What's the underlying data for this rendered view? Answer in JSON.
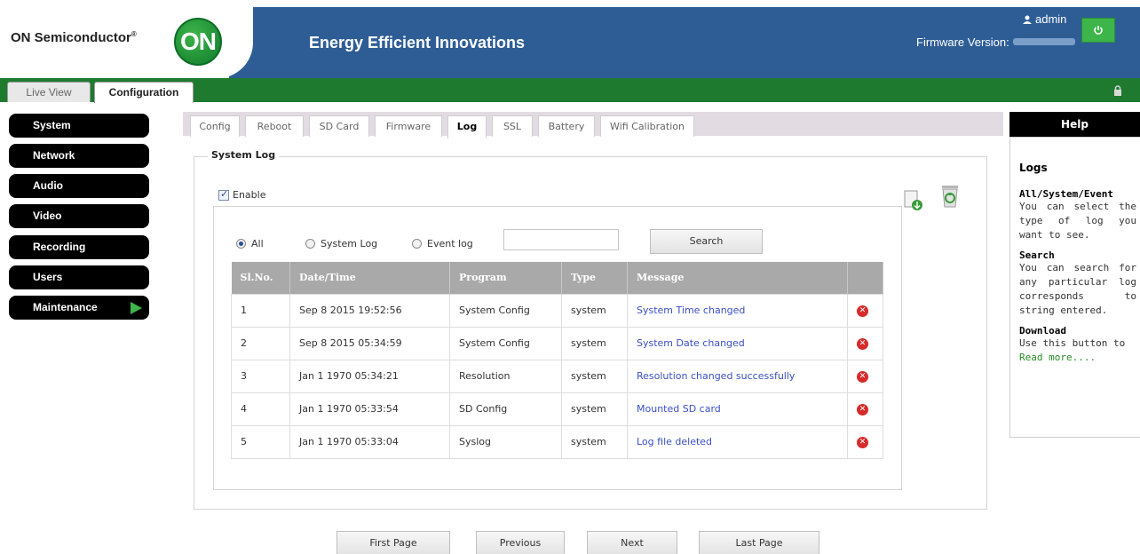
{
  "header": {
    "brand": "ON Semiconductor",
    "brand_mark": "®",
    "logo_text": "ON",
    "tagline": "Energy Efficient Innovations",
    "user": "admin",
    "firmware_label": "Firmware Version:"
  },
  "top_tabs": [
    {
      "label": "Live View"
    },
    {
      "label": "Configuration"
    }
  ],
  "nav": [
    {
      "label": "System"
    },
    {
      "label": "Network"
    },
    {
      "label": "Audio"
    },
    {
      "label": "Video"
    },
    {
      "label": "Recording"
    },
    {
      "label": "Users"
    },
    {
      "label": "Maintenance"
    }
  ],
  "sub_tabs": [
    {
      "label": "Config"
    },
    {
      "label": "Reboot"
    },
    {
      "label": "SD Card"
    },
    {
      "label": "Firmware"
    },
    {
      "label": "Log"
    },
    {
      "label": "SSL"
    },
    {
      "label": "Battery"
    },
    {
      "label": "Wifi Calibration"
    }
  ],
  "log": {
    "legend": "System Log",
    "enable_label": "Enable",
    "filters": [
      {
        "label": "All"
      },
      {
        "label": "System Log"
      },
      {
        "label": "Event log"
      }
    ],
    "search_placeholder": "",
    "search_button": "Search",
    "columns": [
      "Sl.No.",
      "Date/Time",
      "Program",
      "Type",
      "Message",
      ""
    ],
    "rows": [
      {
        "no": "1",
        "datetime": "Sep 8 2015 19:52:56",
        "program": "System Config",
        "type": "system",
        "message": "System Time changed"
      },
      {
        "no": "2",
        "datetime": "Sep 8 2015 05:34:59",
        "program": "System Config",
        "type": "system",
        "message": "System Date changed"
      },
      {
        "no": "3",
        "datetime": "Jan 1 1970 05:34:21",
        "program": "Resolution",
        "type": "system",
        "message": "Resolution changed successfully"
      },
      {
        "no": "4",
        "datetime": "Jan 1 1970 05:33:54",
        "program": "SD Config",
        "type": "system",
        "message": "Mounted SD card"
      },
      {
        "no": "5",
        "datetime": "Jan 1 1970 05:33:04",
        "program": "Syslog",
        "type": "system",
        "message": "Log file deleted"
      }
    ],
    "pager": {
      "first": "First Page",
      "prev": "Previous",
      "next": "Next",
      "last": "Last Page"
    }
  },
  "help": {
    "header": "Help",
    "title": "Logs",
    "sections": [
      {
        "heading": "All/System/Event",
        "text": "You can select the type of log you want to see."
      },
      {
        "heading": "Search",
        "text": "You can search for any particular log corresponds to string entered."
      },
      {
        "heading": "Download",
        "text": "Use this button to"
      }
    ],
    "read_more": "Read more...."
  },
  "colors": {
    "banner": "#2e5d96",
    "tab_bar": "#1e7a2f",
    "accent_green": "#3db54a",
    "link_blue": "#3b4fc4"
  }
}
